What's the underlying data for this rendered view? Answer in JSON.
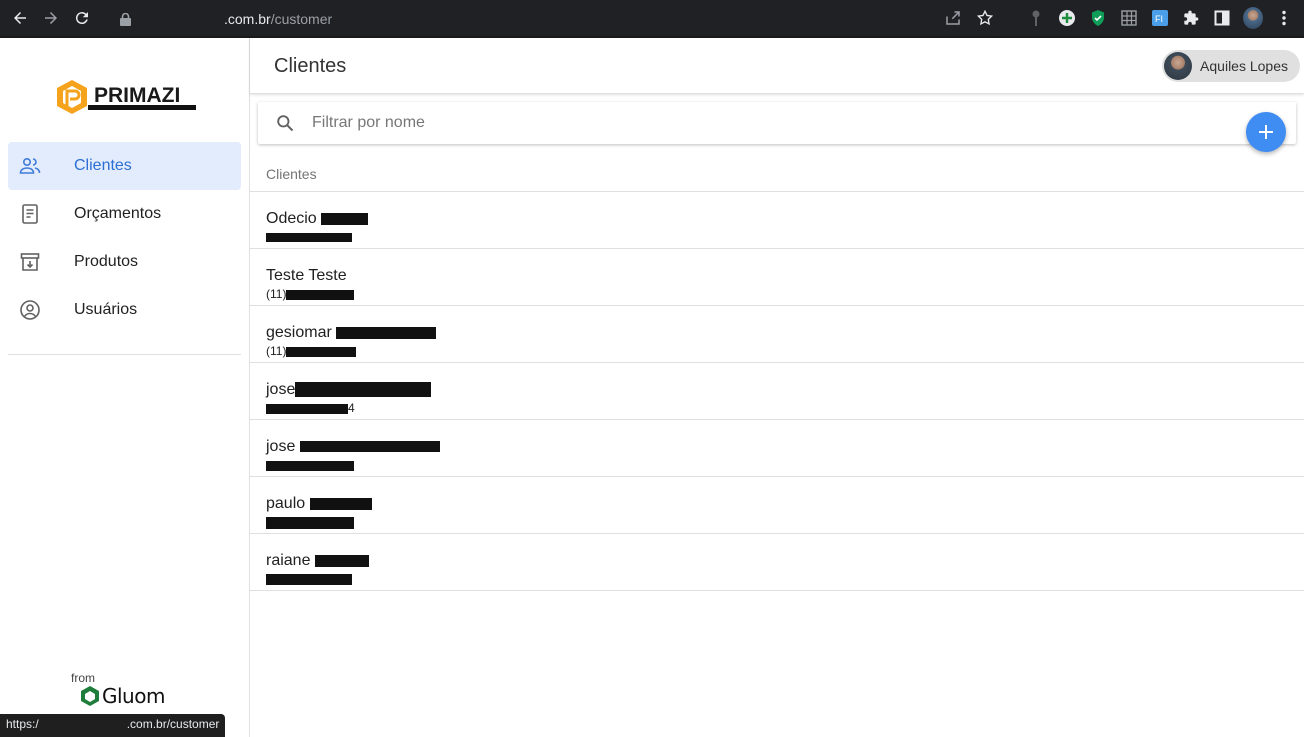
{
  "browser": {
    "url_host_suffix": ".com.br",
    "url_path": "/customer",
    "status_url": ".com.br/customer",
    "status_prefix": "https:/"
  },
  "sidebar": {
    "logo_text": "PRIMAZI",
    "items": [
      {
        "label": "Clientes",
        "icon": "people-icon",
        "active": true
      },
      {
        "label": "Orçamentos",
        "icon": "document-icon",
        "active": false
      },
      {
        "label": "Produtos",
        "icon": "archive-icon",
        "active": false
      },
      {
        "label": "Usuários",
        "icon": "account-circle-icon",
        "active": false
      }
    ],
    "footer_from": "from",
    "footer_brand": "Gluom"
  },
  "header": {
    "title": "Clientes",
    "user_name": "Aquiles Lopes"
  },
  "search": {
    "placeholder": "Filtrar por nome"
  },
  "list": {
    "header": "Clientes",
    "rows": [
      {
        "name": "Odecio",
        "phone": ""
      },
      {
        "name": "Teste Teste",
        "phone": "(11)"
      },
      {
        "name": "gesiomar",
        "phone": "(11)"
      },
      {
        "name": "jose",
        "phone": "4"
      },
      {
        "name": "jose",
        "phone": ""
      },
      {
        "name": "paulo",
        "phone": ""
      },
      {
        "name": "raiane",
        "phone": ""
      }
    ]
  }
}
